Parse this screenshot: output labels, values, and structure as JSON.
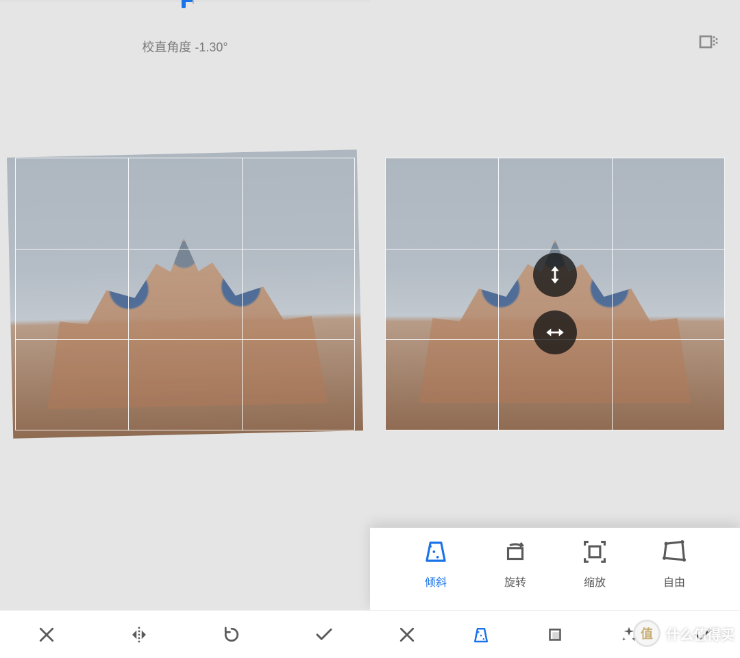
{
  "left": {
    "angle_label": "校直角度 -1.30°",
    "slider": {
      "value_deg": -1.3,
      "thumb_pct": 49,
      "center_pct": 52
    },
    "actions": {
      "close": "close",
      "flip": "flip-horizontal",
      "rotate": "rotate-cw",
      "confirm": "confirm"
    }
  },
  "right": {
    "aspect_button": "aspect-ratio",
    "perspective_controls": {
      "vertical": "tilt-vertical",
      "horizontal": "tilt-horizontal"
    },
    "modes": [
      {
        "key": "tilt",
        "label": "倾斜",
        "active": true
      },
      {
        "key": "rotate",
        "label": "旋转",
        "active": false
      },
      {
        "key": "scale",
        "label": "缩放",
        "active": false
      },
      {
        "key": "free",
        "label": "自由",
        "active": false
      }
    ],
    "actions": {
      "close": "close",
      "perspective": "perspective",
      "crop": "crop",
      "magic": "auto-enhance",
      "confirm": "confirm"
    }
  },
  "watermark": {
    "badge_char": "值",
    "text": "什么值得买"
  },
  "subject": "castle-photo"
}
